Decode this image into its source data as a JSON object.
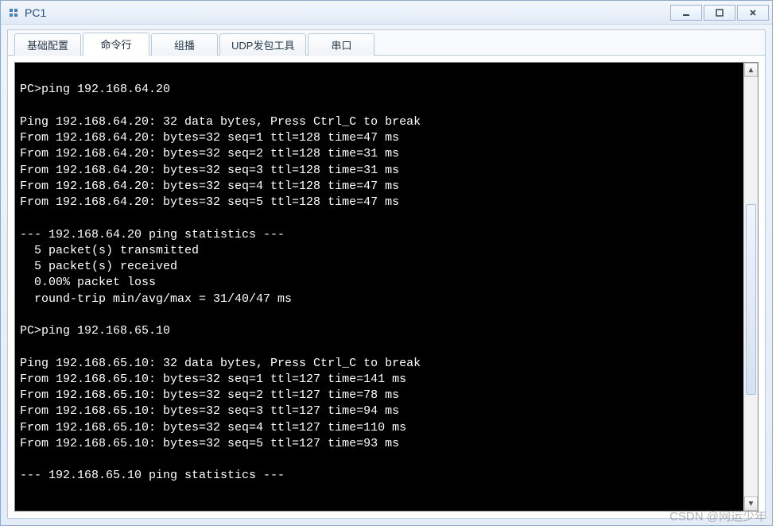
{
  "window": {
    "title": "PC1"
  },
  "tabs": [
    {
      "label": "基础配置",
      "active": false
    },
    {
      "label": "命令行",
      "active": true
    },
    {
      "label": "组播",
      "active": false
    },
    {
      "label": "UDP发包工具",
      "active": false
    },
    {
      "label": "串口",
      "active": false
    }
  ],
  "terminal": {
    "lines": [
      "",
      "PC>ping 192.168.64.20",
      "",
      "Ping 192.168.64.20: 32 data bytes, Press Ctrl_C to break",
      "From 192.168.64.20: bytes=32 seq=1 ttl=128 time=47 ms",
      "From 192.168.64.20: bytes=32 seq=2 ttl=128 time=31 ms",
      "From 192.168.64.20: bytes=32 seq=3 ttl=128 time=31 ms",
      "From 192.168.64.20: bytes=32 seq=4 ttl=128 time=47 ms",
      "From 192.168.64.20: bytes=32 seq=5 ttl=128 time=47 ms",
      "",
      "--- 192.168.64.20 ping statistics ---",
      "  5 packet(s) transmitted",
      "  5 packet(s) received",
      "  0.00% packet loss",
      "  round-trip min/avg/max = 31/40/47 ms",
      "",
      "PC>ping 192.168.65.10",
      "",
      "Ping 192.168.65.10: 32 data bytes, Press Ctrl_C to break",
      "From 192.168.65.10: bytes=32 seq=1 ttl=127 time=141 ms",
      "From 192.168.65.10: bytes=32 seq=2 ttl=127 time=78 ms",
      "From 192.168.65.10: bytes=32 seq=3 ttl=127 time=94 ms",
      "From 192.168.65.10: bytes=32 seq=4 ttl=127 time=110 ms",
      "From 192.168.65.10: bytes=32 seq=5 ttl=127 time=93 ms",
      "",
      "--- 192.168.65.10 ping statistics ---"
    ]
  },
  "watermark": "CSDN @网运少年"
}
